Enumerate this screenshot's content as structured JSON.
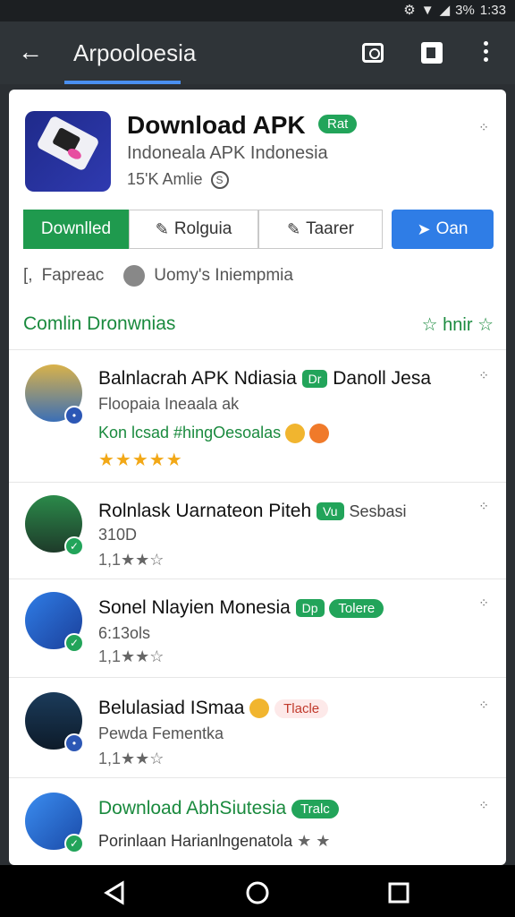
{
  "status_bar": {
    "battery": "3%",
    "time": "1:33"
  },
  "app_bar": {
    "title": "Arpooloesia"
  },
  "app": {
    "name": "Download APK",
    "badge": "Rat",
    "publisher": "Indoneala APK Indonesia",
    "meta": "15'K Amlie"
  },
  "buttons": {
    "download": "Downlled",
    "second": "Rolguia",
    "third": "Taarer",
    "fourth": "Oan"
  },
  "info": {
    "left": "Fapreac",
    "right": "Uomy's Iniempmia"
  },
  "section": {
    "title": "Comlin Dronwnias",
    "right": "hnir"
  },
  "list": [
    {
      "title": "Balnlacrah APK Ndiasia",
      "mini": "Dr",
      "extra": "Danoll Jesa",
      "line1": "Floopaia Ineaala",
      "line1b": "ak",
      "line2": "Kon lcsad #hingOesoalas",
      "rating": "★★★★★"
    },
    {
      "title": "Rolnlask Uarnateon Piteh",
      "mini": "Vu",
      "extra": "Sesbasi",
      "line1": "310D",
      "rating": "1,1★★☆"
    },
    {
      "title": "Sonel Nlayien Monesia",
      "mini": "Dp",
      "pill": "Tolere",
      "line1": "6:13ols",
      "rating": "1,1★★☆"
    },
    {
      "title": "Belulasiad ISmaa",
      "pill": "Tlacle",
      "line1": "Pewda Fementka",
      "rating": "1,1★★☆"
    },
    {
      "title": "Download AbhSiutesia",
      "pill": "Tralc",
      "line1": "Porinlaan Harianlngenatola",
      "rating": "★ ★"
    }
  ]
}
